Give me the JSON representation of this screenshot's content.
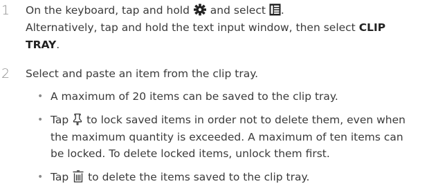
{
  "steps": [
    {
      "number": "1",
      "line1_a": "On the keyboard, tap and hold ",
      "line1_b": " and select ",
      "line1_c": ".",
      "line2": "Alternatively, tap and hold the text input window, then select ",
      "line2_bold": "CLIP",
      "line3_bold": "TRAY",
      "line3_end": "."
    },
    {
      "number": "2",
      "text": "Select and paste an item from the clip tray.",
      "bullets": [
        {
          "bullet": "•",
          "text": "A maximum of 20 items can be saved to the clip tray."
        },
        {
          "bullet": "•",
          "line1_a": "Tap ",
          "line1_b": " to lock saved items in order not to delete them, even when",
          "line2": "the maximum quantity is exceeded. A maximum of ten items can",
          "line3": "be locked. To delete locked items, unlock them first."
        },
        {
          "bullet": "•",
          "line1_a": "Tap ",
          "line1_b": " to delete the items saved to the clip tray."
        }
      ]
    }
  ],
  "icons": {
    "settings": "gear-icon",
    "clip_tray": "clip-tray-icon",
    "lock": "pin-lock-icon",
    "delete": "trash-icon"
  }
}
